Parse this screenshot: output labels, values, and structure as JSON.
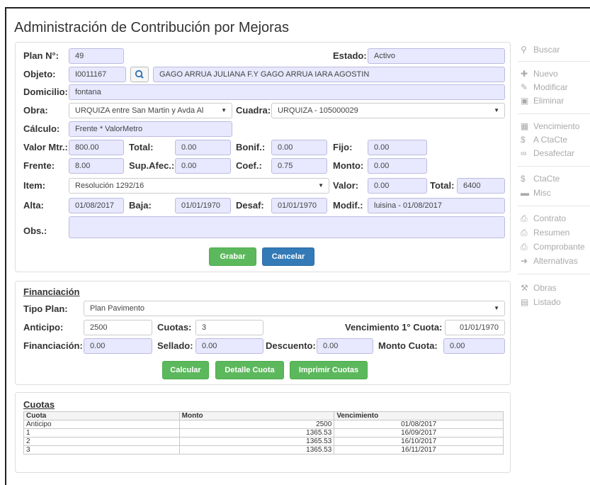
{
  "page_title": "Administración de Contribución por Mejoras",
  "form": {
    "plan_label": "Plan N°:",
    "plan_value": "49",
    "estado_label": "Estado:",
    "estado_value": "Activo",
    "objeto_label": "Objeto:",
    "objeto_code": "I0011167",
    "objeto_name": "GAGO ARRUA JULIANA F.Y GAGO ARRUA IARA AGOSTIN",
    "domicilio_label": "Domicilio:",
    "domicilio_value": "fontana",
    "obra_label": "Obra:",
    "obra_value": "URQUIZA entre San Martin y Avda Al",
    "cuadra_label": "Cuadra:",
    "cuadra_value": "URQUIZA - 105000029",
    "calculo_label": "Cálculo:",
    "calculo_value": "Frente * ValorMetro",
    "valor_mtr_label": "Valor Mtr.:",
    "valor_mtr_value": "800.00",
    "total_label": "Total:",
    "total_value": "0.00",
    "bonif_label": "Bonif.:",
    "bonif_value": "0.00",
    "fijo_label": "Fijo:",
    "fijo_value": "0.00",
    "frente_label": "Frente:",
    "frente_value": "8.00",
    "supafec_label": "Sup.Afec.:",
    "supafec_value": "0.00",
    "coef_label": "Coef.:",
    "coef_value": "0.75",
    "monto_label": "Monto:",
    "monto_value": "0.00",
    "item_label": "Item:",
    "item_value": "Resolución 1292/16",
    "valor_label": "Valor:",
    "valor_value": "0.00",
    "total2_label": "Total:",
    "total2_value": "6400",
    "alta_label": "Alta:",
    "alta_value": "01/08/2017",
    "baja_label": "Baja:",
    "baja_value": "01/01/1970",
    "desaf_label": "Desaf:",
    "desaf_value": "01/01/1970",
    "modif_label": "Modif.:",
    "modif_value": "luisina - 01/08/2017",
    "obs_label": "Obs.:",
    "obs_value": "",
    "grabar": "Grabar",
    "cancelar": "Cancelar"
  },
  "financiacion": {
    "title": "Financiación",
    "tipo_plan_label": "Tipo Plan:",
    "tipo_plan_value": "Plan Pavimento",
    "anticipo_label": "Anticipo:",
    "anticipo_value": "2500",
    "cuotas_label": "Cuotas:",
    "cuotas_value": "3",
    "venc_label": "Vencimiento 1° Cuota:",
    "venc_value": "01/01/1970",
    "financiacion_label": "Financiación:",
    "financiacion_value": "0.00",
    "sellado_label": "Sellado:",
    "sellado_value": "0.00",
    "descuento_label": "Descuento:",
    "descuento_value": "0.00",
    "monto_cuota_label": "Monto Cuota:",
    "monto_cuota_value": "0.00",
    "calcular": "Calcular",
    "detalle_cuota": "Detalle Cuota",
    "imprimir_cuotas": "Imprimir Cuotas"
  },
  "cuotas": {
    "title": "Cuotas",
    "headers": [
      "Cuota",
      "Monto",
      "Vencimiento"
    ],
    "rows": [
      [
        "Anticipo",
        "2500",
        "01/08/2017"
      ],
      [
        "1",
        "1365.53",
        "16/09/2017"
      ],
      [
        "2",
        "1365.53",
        "16/10/2017"
      ],
      [
        "3",
        "1365.53",
        "16/11/2017"
      ]
    ]
  },
  "sidebar": {
    "buscar": "Buscar",
    "nuevo": "Nuevo",
    "modificar": "Modificar",
    "eliminar": "Eliminar",
    "vencimiento": "Vencimiento",
    "a_ctacte": "A CtaCte",
    "desafectar": "Desafectar",
    "ctacte": "CtaCte",
    "misc": "Misc",
    "contrato": "Contrato",
    "resumen": "Resumen",
    "comprobante": "Comprobante",
    "alternativas": "Alternativas",
    "obras": "Obras",
    "listado": "Listado"
  },
  "colors": {
    "field_bg": "#e8e8ff",
    "green": "#5cb85c",
    "blue": "#337ab7"
  }
}
